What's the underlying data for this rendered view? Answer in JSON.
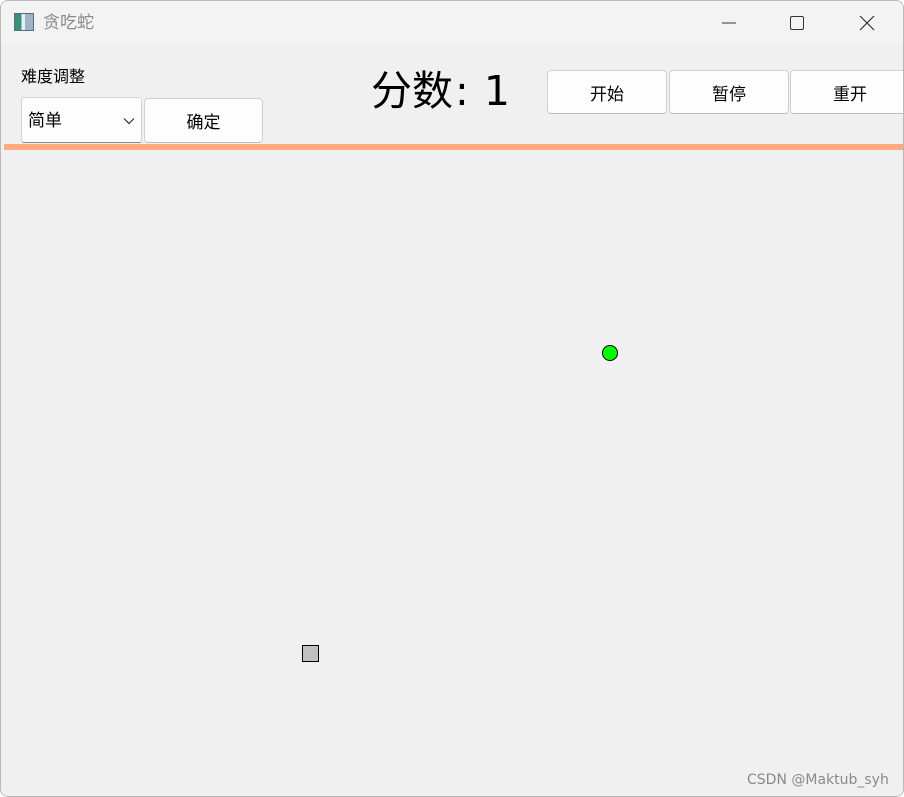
{
  "window": {
    "title": "贪吃蛇"
  },
  "difficulty": {
    "label": "难度调整",
    "selected": "简单",
    "confirm_label": "确定"
  },
  "score": {
    "label": "分数",
    "separator": ":",
    "value": "1"
  },
  "controls": {
    "start_label": "开始",
    "pause_label": "暂停",
    "restart_label": "重开"
  },
  "board": {
    "divider_color": "#ffaa7f",
    "food_color": "#00ff00",
    "snake_color": "#c0c0c0"
  },
  "watermark": "CSDN @Maktub_syh"
}
